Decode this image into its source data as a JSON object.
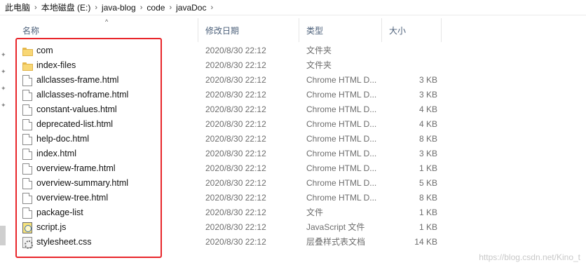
{
  "breadcrumb": {
    "items": [
      "此电脑",
      "本地磁盘 (E:)",
      "java-blog",
      "code",
      "javaDoc"
    ],
    "separator": "›"
  },
  "header": {
    "name": "名称",
    "date": "修改日期",
    "type": "类型",
    "size": "大小",
    "sort_indicator": "^"
  },
  "files": [
    {
      "icon": "folder-icon",
      "name": "com",
      "date": "2020/8/30 22:12",
      "type": "文件夹",
      "size": ""
    },
    {
      "icon": "folder-icon",
      "name": "index-files",
      "date": "2020/8/30 22:12",
      "type": "文件夹",
      "size": ""
    },
    {
      "icon": "html-file-icon",
      "name": "allclasses-frame.html",
      "date": "2020/8/30 22:12",
      "type": "Chrome HTML D...",
      "size": "3 KB"
    },
    {
      "icon": "html-file-icon",
      "name": "allclasses-noframe.html",
      "date": "2020/8/30 22:12",
      "type": "Chrome HTML D...",
      "size": "3 KB"
    },
    {
      "icon": "html-file-icon",
      "name": "constant-values.html",
      "date": "2020/8/30 22:12",
      "type": "Chrome HTML D...",
      "size": "4 KB"
    },
    {
      "icon": "html-file-icon",
      "name": "deprecated-list.html",
      "date": "2020/8/30 22:12",
      "type": "Chrome HTML D...",
      "size": "4 KB"
    },
    {
      "icon": "html-file-icon",
      "name": "help-doc.html",
      "date": "2020/8/30 22:12",
      "type": "Chrome HTML D...",
      "size": "8 KB"
    },
    {
      "icon": "html-file-icon",
      "name": "index.html",
      "date": "2020/8/30 22:12",
      "type": "Chrome HTML D...",
      "size": "3 KB"
    },
    {
      "icon": "html-file-icon",
      "name": "overview-frame.html",
      "date": "2020/8/30 22:12",
      "type": "Chrome HTML D...",
      "size": "1 KB"
    },
    {
      "icon": "html-file-icon",
      "name": "overview-summary.html",
      "date": "2020/8/30 22:12",
      "type": "Chrome HTML D...",
      "size": "5 KB"
    },
    {
      "icon": "html-file-icon",
      "name": "overview-tree.html",
      "date": "2020/8/30 22:12",
      "type": "Chrome HTML D...",
      "size": "8 KB"
    },
    {
      "icon": "file-icon",
      "name": "package-list",
      "date": "2020/8/30 22:12",
      "type": "文件",
      "size": "1 KB"
    },
    {
      "icon": "js-file-icon",
      "name": "script.js",
      "date": "2020/8/30 22:12",
      "type": "JavaScript 文件",
      "size": "1 KB"
    },
    {
      "icon": "css-file-icon",
      "name": "stylesheet.css",
      "date": "2020/8/30 22:12",
      "type": "层叠样式表文档",
      "size": "14 KB"
    }
  ],
  "watermark": "https://blog.csdn.net/Kino_t",
  "colors": {
    "highlight": "#e8252a",
    "header_text": "#4c607a",
    "folder": "#f8d775"
  }
}
